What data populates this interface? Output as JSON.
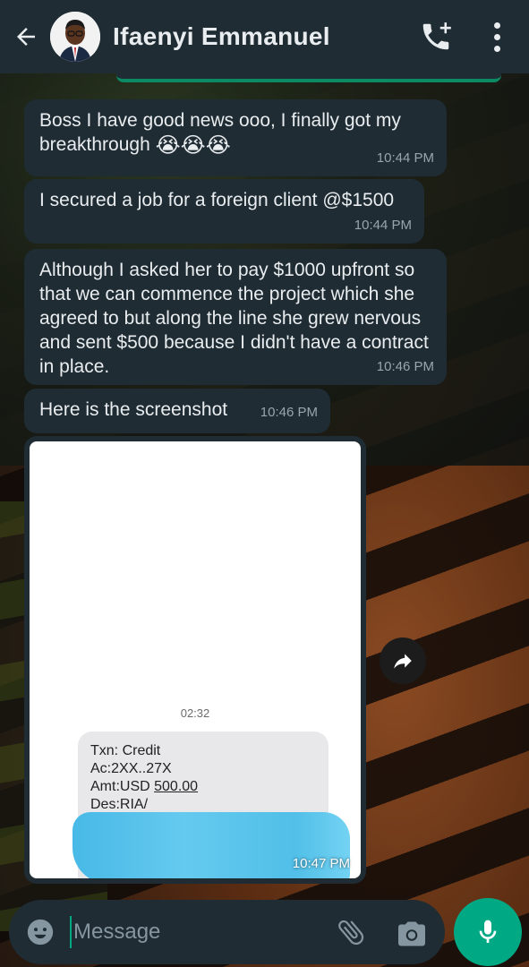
{
  "header": {
    "contact_name": "Ifaenyi Emmanuel",
    "icons": [
      "back-arrow-icon",
      "avatar",
      "add-call-icon",
      "more-vertical-icon"
    ]
  },
  "messages": [
    {
      "text": "Boss I have good news ooo, I finally got my breakthrough",
      "emoji": "😭😭😭",
      "time": "10:44 PM"
    },
    {
      "text": "I secured a job for a foreign client @$1500",
      "time": "10:44 PM"
    },
    {
      "text": "Although I asked her to pay $1000 upfront so that we can commence the project which she agreed to but along the line she grew nervous and sent $500 because I didn't have a contract in place.",
      "time": "10:46 PM"
    },
    {
      "text": "Here is the screenshot",
      "time": "10:46 PM"
    }
  ],
  "image_message": {
    "time": "10:47 PM",
    "screenshot": {
      "sms_time": "02:32",
      "lines": {
        "txn": "Txn: Credit",
        "ac": "Ac:2XX..27X",
        "amt_prefix": "Amt:USD ",
        "amt_value": "500.00",
        "des": "Des:RIA/"
      }
    }
  },
  "input": {
    "placeholder": "Message"
  },
  "colors": {
    "header_bg": "#1f2c34",
    "bubble_bg": "#1f2c34",
    "accent": "#00a884"
  }
}
